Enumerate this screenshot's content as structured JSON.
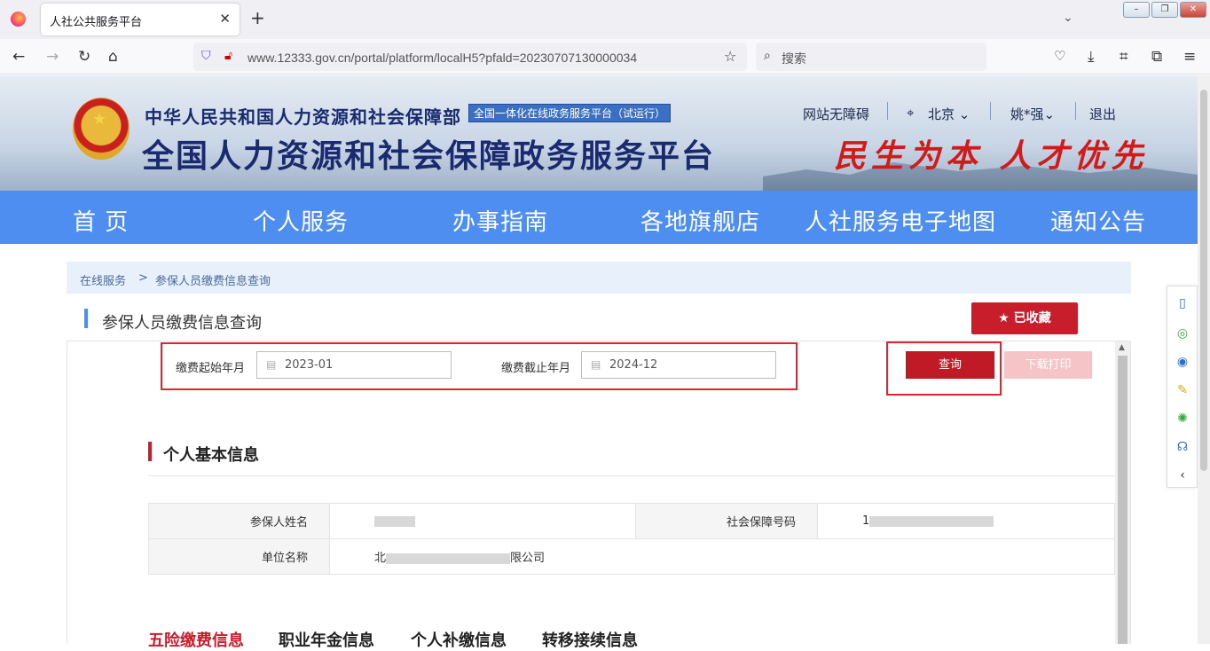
{
  "browser": {
    "tab_title": "人社公共服务平台",
    "url": "www.12333.gov.cn/portal/platform/localH5?pfald=20230707130000034",
    "search_placeholder": "搜索"
  },
  "header": {
    "ministry": "中华人民共和国人力资源和社会保障部",
    "badge": "全国一体化在线政务服务平台（试运行）",
    "platform": "全国人力资源和社会保障政务服务平台",
    "slogan": "民生为本 人才优先",
    "links": {
      "accessible": "网站无障碍",
      "city": "北京",
      "user": "姚*强",
      "logout": "退出"
    }
  },
  "main_nav": [
    "首 页",
    "个人服务",
    "办事指南",
    "各地旗舰店",
    "人社服务电子地图",
    "通知公告"
  ],
  "breadcrumb": {
    "root": "在线服务",
    "sep": ">",
    "current": "参保人员缴费信息查询"
  },
  "page": {
    "title": "参保人员缴费信息查询",
    "fav_label": "已收藏",
    "start_label": "缴费起始年月",
    "start_value": "2023-01",
    "end_label": "缴费截止年月",
    "end_value": "2024-12",
    "query_label": "查询",
    "download_label": "下载打印"
  },
  "basic_info": {
    "title": "个人基本信息",
    "name_label": "参保人姓名",
    "ssn_label": "社会保障号码",
    "ssn_prefix": "1",
    "company_label": "单位名称",
    "company_prefix": "北",
    "company_suffix": "限公司"
  },
  "tabs": [
    "五险缴费信息",
    "职业年金信息",
    "个人补缴信息",
    "转移接续信息"
  ],
  "colors": {
    "nav_blue": "#4d8ef0",
    "brand_red": "#c81d2a",
    "highlight_red": "#e0262c"
  }
}
